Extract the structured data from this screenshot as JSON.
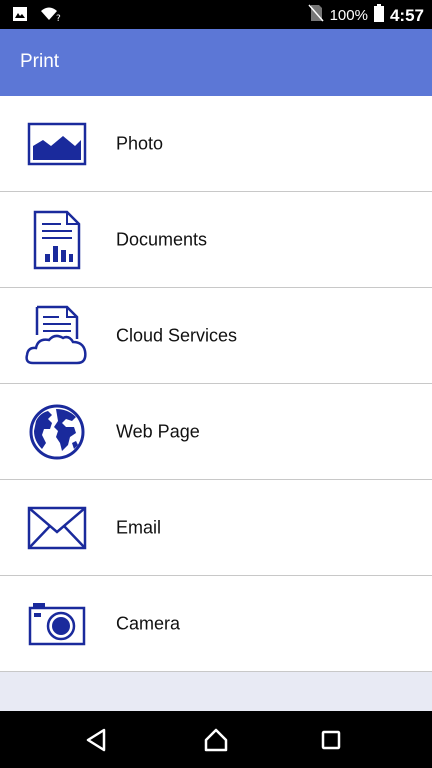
{
  "status_bar": {
    "battery_percent": "100%",
    "time": "4:57",
    "icons": [
      "image-icon",
      "wifi-question-icon",
      "no-sim-icon",
      "battery-icon"
    ]
  },
  "app_bar": {
    "title": "Print",
    "color": "#5c77d6"
  },
  "menu": {
    "items": [
      {
        "label": "Photo",
        "icon": "photo-icon"
      },
      {
        "label": "Documents",
        "icon": "document-icon"
      },
      {
        "label": "Cloud Services",
        "icon": "cloud-document-icon"
      },
      {
        "label": "Web Page",
        "icon": "globe-icon"
      },
      {
        "label": "Email",
        "icon": "envelope-icon"
      },
      {
        "label": "Camera",
        "icon": "camera-icon"
      }
    ]
  },
  "nav_bar": {
    "buttons": [
      "back-icon",
      "home-icon",
      "recents-icon"
    ]
  },
  "colors": {
    "icon_blue": "#1a2a9c",
    "background": "#e8eaf4"
  }
}
